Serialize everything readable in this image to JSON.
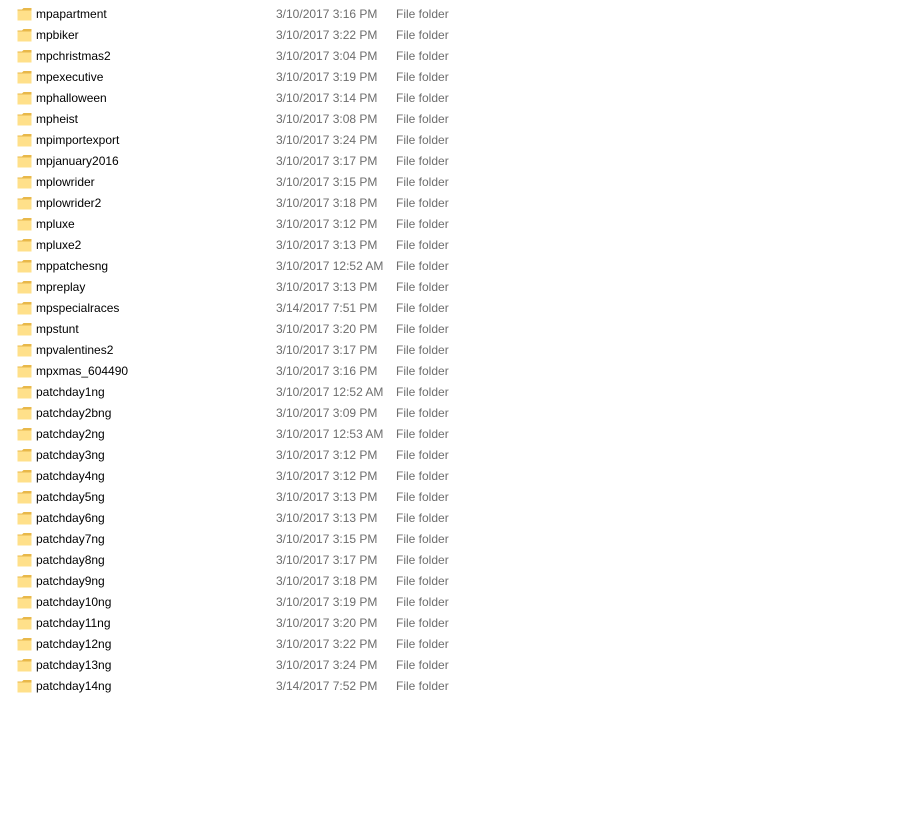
{
  "colors": {
    "folder_fill": "#ffe08a",
    "folder_back": "#e8b84a",
    "secondary_text": "#6d6d6d",
    "hover": "#e5f3ff"
  },
  "icon": "folder-icon",
  "files": [
    {
      "name": "mpapartment",
      "date": "3/10/2017 3:16 PM",
      "type": "File folder"
    },
    {
      "name": "mpbiker",
      "date": "3/10/2017 3:22 PM",
      "type": "File folder"
    },
    {
      "name": "mpchristmas2",
      "date": "3/10/2017 3:04 PM",
      "type": "File folder"
    },
    {
      "name": "mpexecutive",
      "date": "3/10/2017 3:19 PM",
      "type": "File folder"
    },
    {
      "name": "mphalloween",
      "date": "3/10/2017 3:14 PM",
      "type": "File folder"
    },
    {
      "name": "mpheist",
      "date": "3/10/2017 3:08 PM",
      "type": "File folder"
    },
    {
      "name": "mpimportexport",
      "date": "3/10/2017 3:24 PM",
      "type": "File folder"
    },
    {
      "name": "mpjanuary2016",
      "date": "3/10/2017 3:17 PM",
      "type": "File folder"
    },
    {
      "name": "mplowrider",
      "date": "3/10/2017 3:15 PM",
      "type": "File folder"
    },
    {
      "name": "mplowrider2",
      "date": "3/10/2017 3:18 PM",
      "type": "File folder"
    },
    {
      "name": "mpluxe",
      "date": "3/10/2017 3:12 PM",
      "type": "File folder"
    },
    {
      "name": "mpluxe2",
      "date": "3/10/2017 3:13 PM",
      "type": "File folder"
    },
    {
      "name": "mppatchesng",
      "date": "3/10/2017 12:52 AM",
      "type": "File folder"
    },
    {
      "name": "mpreplay",
      "date": "3/10/2017 3:13 PM",
      "type": "File folder"
    },
    {
      "name": "mpspecialraces",
      "date": "3/14/2017 7:51 PM",
      "type": "File folder"
    },
    {
      "name": "mpstunt",
      "date": "3/10/2017 3:20 PM",
      "type": "File folder"
    },
    {
      "name": "mpvalentines2",
      "date": "3/10/2017 3:17 PM",
      "type": "File folder"
    },
    {
      "name": "mpxmas_604490",
      "date": "3/10/2017 3:16 PM",
      "type": "File folder"
    },
    {
      "name": "patchday1ng",
      "date": "3/10/2017 12:52 AM",
      "type": "File folder"
    },
    {
      "name": "patchday2bng",
      "date": "3/10/2017 3:09 PM",
      "type": "File folder"
    },
    {
      "name": "patchday2ng",
      "date": "3/10/2017 12:53 AM",
      "type": "File folder"
    },
    {
      "name": "patchday3ng",
      "date": "3/10/2017 3:12 PM",
      "type": "File folder"
    },
    {
      "name": "patchday4ng",
      "date": "3/10/2017 3:12 PM",
      "type": "File folder"
    },
    {
      "name": "patchday5ng",
      "date": "3/10/2017 3:13 PM",
      "type": "File folder"
    },
    {
      "name": "patchday6ng",
      "date": "3/10/2017 3:13 PM",
      "type": "File folder"
    },
    {
      "name": "patchday7ng",
      "date": "3/10/2017 3:15 PM",
      "type": "File folder"
    },
    {
      "name": "patchday8ng",
      "date": "3/10/2017 3:17 PM",
      "type": "File folder"
    },
    {
      "name": "patchday9ng",
      "date": "3/10/2017 3:18 PM",
      "type": "File folder"
    },
    {
      "name": "patchday10ng",
      "date": "3/10/2017 3:19 PM",
      "type": "File folder"
    },
    {
      "name": "patchday11ng",
      "date": "3/10/2017 3:20 PM",
      "type": "File folder"
    },
    {
      "name": "patchday12ng",
      "date": "3/10/2017 3:22 PM",
      "type": "File folder"
    },
    {
      "name": "patchday13ng",
      "date": "3/10/2017 3:24 PM",
      "type": "File folder"
    },
    {
      "name": "patchday14ng",
      "date": "3/14/2017 7:52 PM",
      "type": "File folder"
    }
  ]
}
